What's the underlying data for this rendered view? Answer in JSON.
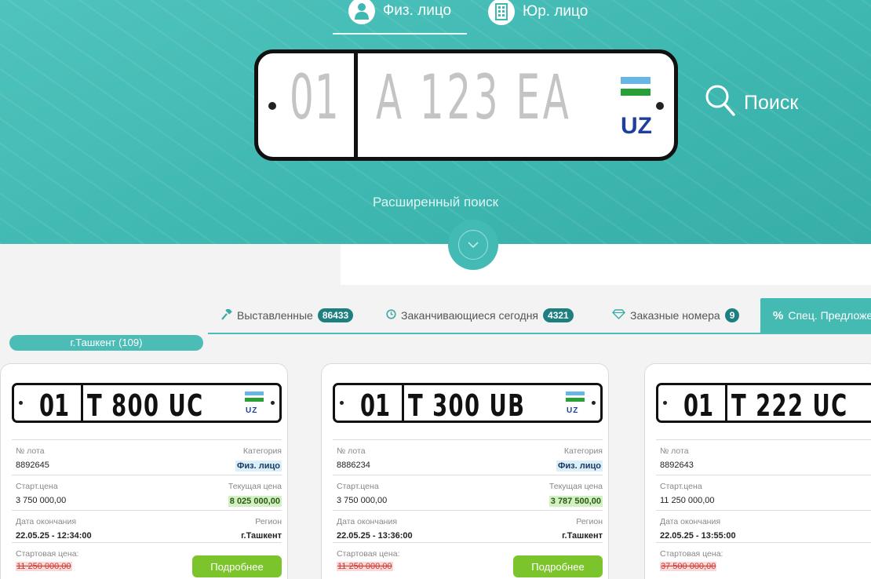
{
  "hero": {
    "person_tabs": [
      {
        "label": "Физ. лицо",
        "icon": "person-icon"
      },
      {
        "label": "Юр. лицо",
        "icon": "building-icon"
      }
    ],
    "plate": {
      "region": "01",
      "number": "A 123 EA",
      "country": "UZ"
    },
    "search_label": "Поиск",
    "advanced_search": "Расширенный поиск"
  },
  "tabs": [
    {
      "label": "Выставленные",
      "badge": "86433",
      "icon": "gavel-icon"
    },
    {
      "label": "Заканчивающиеся сегодня",
      "badge": "4321",
      "icon": "clock-icon"
    },
    {
      "label": "Заказные номера",
      "badge": "9",
      "icon": "diamond-icon"
    },
    {
      "label": "Спец. Предложения",
      "icon": "percent-icon"
    }
  ],
  "region_filter": "г.Ташкент (109)",
  "labels": {
    "lot": "№ лота",
    "category": "Категория",
    "start_price": "Старт.цена",
    "current_price": "Текущая цена",
    "end_date": "Дата окончания",
    "region": "Регион",
    "starting_price": "Стартовая цена:",
    "more": "Подробнее"
  },
  "cards": [
    {
      "region": "01",
      "number": "T 800 UC",
      "country": "UZ",
      "lot": "8892645",
      "category": "Физ. лицо",
      "start_price": "3 750 000,00",
      "current_price": "8 025 000,00",
      "end_date": "22.05.25 - 12:34:00",
      "region_name": "г.Ташкент",
      "old_price": "11 250 000,00"
    },
    {
      "region": "01",
      "number": "T 300 UB",
      "country": "UZ",
      "lot": "8886234",
      "category": "Физ. лицо",
      "start_price": "3 750 000,00",
      "current_price": "3 787 500,00",
      "end_date": "22.05.25 - 13:36:00",
      "region_name": "г.Ташкент",
      "old_price": "11 250 000,00"
    },
    {
      "region": "01",
      "number": "T 222 UC",
      "lot": "8892643",
      "start_price": "11 250 000,00",
      "end_date": "22.05.25 - 13:55:00",
      "old_price": "37 500 000,00"
    }
  ],
  "colors": {
    "accent": "#45bab3",
    "button": "#7cc42b",
    "badge": "#1e7f80"
  }
}
